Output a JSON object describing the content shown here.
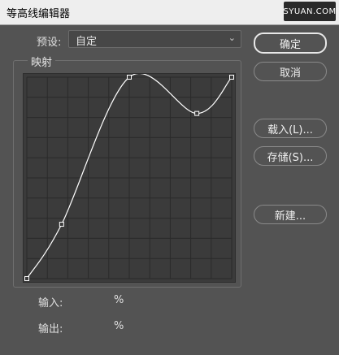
{
  "window": {
    "title": "等高线编辑器",
    "watermark": "SYUAN.COM"
  },
  "preset": {
    "label": "预设:",
    "value": "自定"
  },
  "mapping": {
    "label": "映射"
  },
  "io": {
    "input_label": "输入:",
    "input_unit": "%",
    "output_label": "输出:",
    "output_unit": "%"
  },
  "buttons": {
    "ok": "确定",
    "cancel": "取消",
    "load": "载入(L)...",
    "save": "存储(S)...",
    "new": "新建..."
  },
  "curve": {
    "points": [
      {
        "input": 0,
        "output": 0
      },
      {
        "input": 17,
        "output": 27
      },
      {
        "input": 50,
        "output": 100
      },
      {
        "input": 83,
        "output": 82
      },
      {
        "input": 100,
        "output": 100
      }
    ]
  },
  "colors": {
    "background": "#535353",
    "graph_bg": "#3b3b3b",
    "grid": "#2a2a2a",
    "curve": "#ffffff"
  }
}
